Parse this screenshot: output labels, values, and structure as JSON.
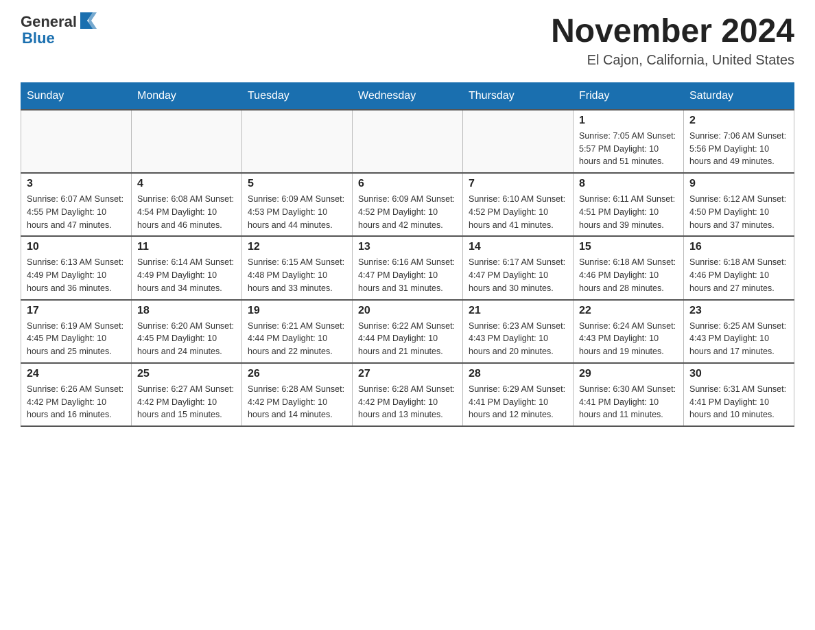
{
  "logo": {
    "general": "General",
    "blue": "Blue"
  },
  "title": "November 2024",
  "location": "El Cajon, California, United States",
  "days_of_week": [
    "Sunday",
    "Monday",
    "Tuesday",
    "Wednesday",
    "Thursday",
    "Friday",
    "Saturday"
  ],
  "weeks": [
    [
      {
        "day": "",
        "info": ""
      },
      {
        "day": "",
        "info": ""
      },
      {
        "day": "",
        "info": ""
      },
      {
        "day": "",
        "info": ""
      },
      {
        "day": "",
        "info": ""
      },
      {
        "day": "1",
        "info": "Sunrise: 7:05 AM\nSunset: 5:57 PM\nDaylight: 10 hours and 51 minutes."
      },
      {
        "day": "2",
        "info": "Sunrise: 7:06 AM\nSunset: 5:56 PM\nDaylight: 10 hours and 49 minutes."
      }
    ],
    [
      {
        "day": "3",
        "info": "Sunrise: 6:07 AM\nSunset: 4:55 PM\nDaylight: 10 hours and 47 minutes."
      },
      {
        "day": "4",
        "info": "Sunrise: 6:08 AM\nSunset: 4:54 PM\nDaylight: 10 hours and 46 minutes."
      },
      {
        "day": "5",
        "info": "Sunrise: 6:09 AM\nSunset: 4:53 PM\nDaylight: 10 hours and 44 minutes."
      },
      {
        "day": "6",
        "info": "Sunrise: 6:09 AM\nSunset: 4:52 PM\nDaylight: 10 hours and 42 minutes."
      },
      {
        "day": "7",
        "info": "Sunrise: 6:10 AM\nSunset: 4:52 PM\nDaylight: 10 hours and 41 minutes."
      },
      {
        "day": "8",
        "info": "Sunrise: 6:11 AM\nSunset: 4:51 PM\nDaylight: 10 hours and 39 minutes."
      },
      {
        "day": "9",
        "info": "Sunrise: 6:12 AM\nSunset: 4:50 PM\nDaylight: 10 hours and 37 minutes."
      }
    ],
    [
      {
        "day": "10",
        "info": "Sunrise: 6:13 AM\nSunset: 4:49 PM\nDaylight: 10 hours and 36 minutes."
      },
      {
        "day": "11",
        "info": "Sunrise: 6:14 AM\nSunset: 4:49 PM\nDaylight: 10 hours and 34 minutes."
      },
      {
        "day": "12",
        "info": "Sunrise: 6:15 AM\nSunset: 4:48 PM\nDaylight: 10 hours and 33 minutes."
      },
      {
        "day": "13",
        "info": "Sunrise: 6:16 AM\nSunset: 4:47 PM\nDaylight: 10 hours and 31 minutes."
      },
      {
        "day": "14",
        "info": "Sunrise: 6:17 AM\nSunset: 4:47 PM\nDaylight: 10 hours and 30 minutes."
      },
      {
        "day": "15",
        "info": "Sunrise: 6:18 AM\nSunset: 4:46 PM\nDaylight: 10 hours and 28 minutes."
      },
      {
        "day": "16",
        "info": "Sunrise: 6:18 AM\nSunset: 4:46 PM\nDaylight: 10 hours and 27 minutes."
      }
    ],
    [
      {
        "day": "17",
        "info": "Sunrise: 6:19 AM\nSunset: 4:45 PM\nDaylight: 10 hours and 25 minutes."
      },
      {
        "day": "18",
        "info": "Sunrise: 6:20 AM\nSunset: 4:45 PM\nDaylight: 10 hours and 24 minutes."
      },
      {
        "day": "19",
        "info": "Sunrise: 6:21 AM\nSunset: 4:44 PM\nDaylight: 10 hours and 22 minutes."
      },
      {
        "day": "20",
        "info": "Sunrise: 6:22 AM\nSunset: 4:44 PM\nDaylight: 10 hours and 21 minutes."
      },
      {
        "day": "21",
        "info": "Sunrise: 6:23 AM\nSunset: 4:43 PM\nDaylight: 10 hours and 20 minutes."
      },
      {
        "day": "22",
        "info": "Sunrise: 6:24 AM\nSunset: 4:43 PM\nDaylight: 10 hours and 19 minutes."
      },
      {
        "day": "23",
        "info": "Sunrise: 6:25 AM\nSunset: 4:43 PM\nDaylight: 10 hours and 17 minutes."
      }
    ],
    [
      {
        "day": "24",
        "info": "Sunrise: 6:26 AM\nSunset: 4:42 PM\nDaylight: 10 hours and 16 minutes."
      },
      {
        "day": "25",
        "info": "Sunrise: 6:27 AM\nSunset: 4:42 PM\nDaylight: 10 hours and 15 minutes."
      },
      {
        "day": "26",
        "info": "Sunrise: 6:28 AM\nSunset: 4:42 PM\nDaylight: 10 hours and 14 minutes."
      },
      {
        "day": "27",
        "info": "Sunrise: 6:28 AM\nSunset: 4:42 PM\nDaylight: 10 hours and 13 minutes."
      },
      {
        "day": "28",
        "info": "Sunrise: 6:29 AM\nSunset: 4:41 PM\nDaylight: 10 hours and 12 minutes."
      },
      {
        "day": "29",
        "info": "Sunrise: 6:30 AM\nSunset: 4:41 PM\nDaylight: 10 hours and 11 minutes."
      },
      {
        "day": "30",
        "info": "Sunrise: 6:31 AM\nSunset: 4:41 PM\nDaylight: 10 hours and 10 minutes."
      }
    ]
  ]
}
